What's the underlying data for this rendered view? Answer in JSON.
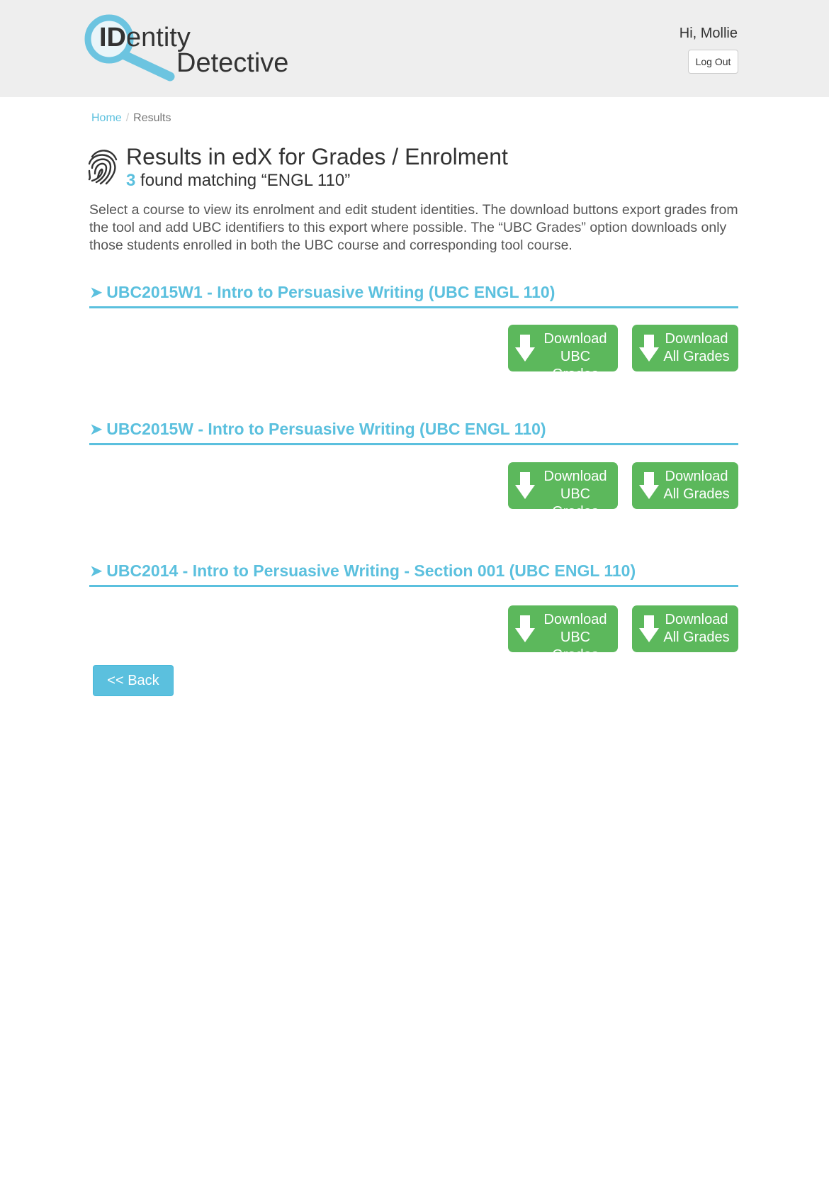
{
  "header": {
    "logo_part1_bold": "ID",
    "logo_part1_rest": "entity",
    "logo_part2": "Detective",
    "greeting": "Hi, Mollie",
    "logout_label": "Log Out"
  },
  "breadcrumb": {
    "home": "Home",
    "separator": "/",
    "current": "Results"
  },
  "main": {
    "title": "Results in edX for Grades / Enrolment",
    "result_count": "3",
    "subtitle_rest": "found matching “ENGL 110”",
    "description": "Select a course to view its enrolment and edit student identities. The download buttons export grades from the tool and add UBC identifiers to this export where possible. The “UBC Grades” option downloads only those students enrolled in both the UBC course and corresponding tool course."
  },
  "courses": [
    {
      "arrow": "➤",
      "title": "UBC2015W1 - Intro to Persuasive Writing (UBC ENGL 110)",
      "ubc_btn": [
        "Download",
        "UBC Grades"
      ],
      "all_btn": [
        "Download",
        "All Grades"
      ]
    },
    {
      "arrow": "➤",
      "title": "UBC2015W - Intro to Persuasive Writing (UBC ENGL 110)",
      "ubc_btn": [
        "Download",
        "UBC Grades"
      ],
      "all_btn": [
        "Download",
        "All Grades"
      ]
    },
    {
      "arrow": "➤",
      "title": "UBC2014 - Intro to Persuasive Writing - Section 001 (UBC ENGL 110)",
      "ubc_btn": [
        "Download",
        "UBC Grades"
      ],
      "all_btn": [
        "Download",
        "All Grades"
      ]
    }
  ],
  "back_label": "<< Back",
  "icons": {
    "logo": "magnifier-icon",
    "fingerprint": "fingerprint-icon",
    "download": "download-arrow-icon"
  },
  "colors": {
    "accent": "#5bc0de",
    "download_button": "#5cb85c",
    "header_bg": "#eeeeee"
  }
}
